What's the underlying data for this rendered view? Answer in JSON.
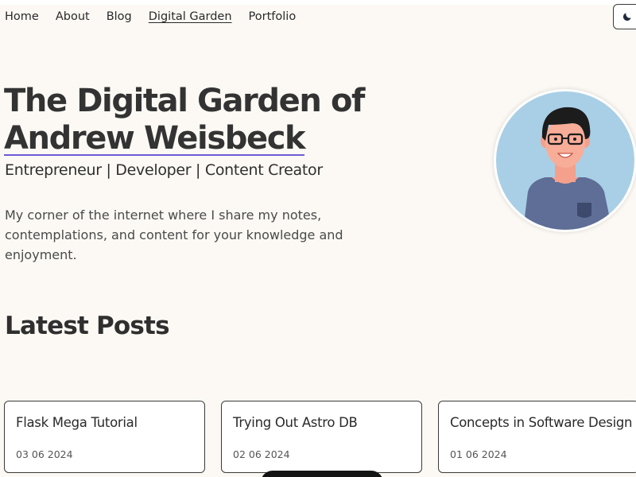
{
  "nav": {
    "items": [
      {
        "label": "Home",
        "active": false
      },
      {
        "label": "About",
        "active": false
      },
      {
        "label": "Blog",
        "active": false
      },
      {
        "label": "Digital Garden",
        "active": true
      },
      {
        "label": "Portfolio",
        "active": false
      }
    ],
    "theme_toggle_icon": "moon-icon"
  },
  "hero": {
    "title_line1": "The Digital Garden of",
    "title_line2": "Andrew Weisbeck",
    "subtitle": "Entrepreneur | Developer | Content Creator",
    "description": "My corner of the internet where I share my notes, contemplations, and content for your knowledge and enjoyment.",
    "avatar_icon": "avatar-illustration"
  },
  "posts": {
    "heading": "Latest Posts",
    "items": [
      {
        "title": "Flask Mega Tutorial",
        "date": "03 06 2024"
      },
      {
        "title": "Trying Out Astro DB",
        "date": "02 06 2024"
      },
      {
        "title": "Concepts in Software Design",
        "date": "01 06 2024"
      }
    ]
  },
  "colors": {
    "background": "#fcf9f4",
    "accent_underline": "#6e5bd6",
    "avatar_bg": "#a9cfe6",
    "shirt": "#5e6e96"
  }
}
